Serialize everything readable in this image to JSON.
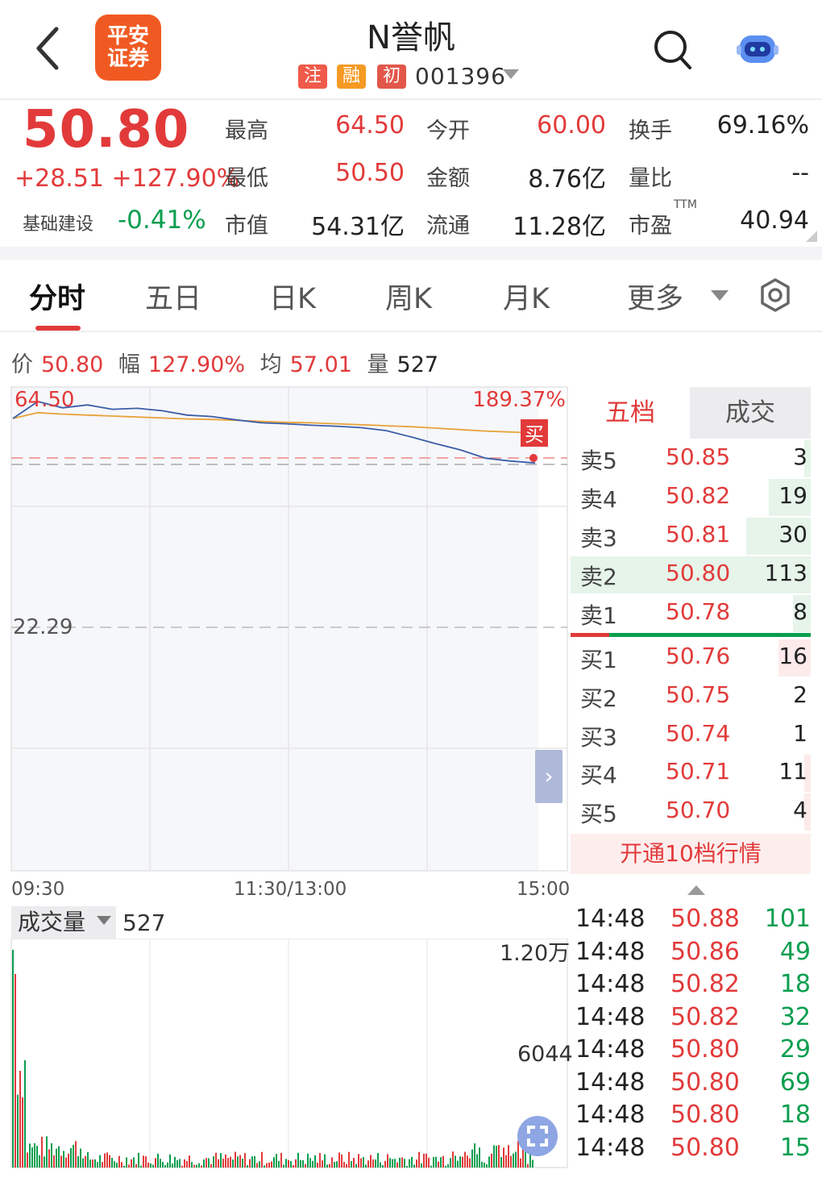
{
  "header": {
    "logo_line1": "平安",
    "logo_line2": "证券",
    "stock_name": "N誉帆",
    "tags": [
      "注",
      "融",
      "初"
    ],
    "stock_code": "001396",
    "icons": [
      "chevron-left-icon",
      "search-icon",
      "robot-assistant-icon"
    ]
  },
  "quote": {
    "price": "50.80",
    "change": "+28.51 +127.90%",
    "sector_name": "基础建设",
    "sector_change": "-0.41%",
    "fields": [
      {
        "label": "最高",
        "value": "64.50",
        "color": "#e23a3a"
      },
      {
        "label": "今开",
        "value": "60.00",
        "color": "#e23a3a"
      },
      {
        "label": "换手",
        "value": "69.16%",
        "color": "#222222"
      },
      {
        "label": "最低",
        "value": "50.50",
        "color": "#e23a3a"
      },
      {
        "label": "金额",
        "value": "8.76亿",
        "color": "#222222"
      },
      {
        "label": "量比",
        "value": "--",
        "color": "#222222"
      },
      {
        "label": "市值",
        "value": "54.31亿",
        "color": "#222222"
      },
      {
        "label": "流通",
        "value": "11.28亿",
        "color": "#222222"
      },
      {
        "label": "市盈",
        "value": "40.94",
        "color": "#222222"
      }
    ],
    "ttm_label": "TTM"
  },
  "tabs": [
    "分时",
    "五日",
    "日K",
    "周K",
    "月K",
    "更多"
  ],
  "info_line": {
    "price_label": "价",
    "price": "50.80",
    "amp_label": "幅",
    "amp": "127.90%",
    "avg_label": "均",
    "avg": "57.01",
    "vol_label": "量",
    "vol": "527"
  },
  "chart": {
    "high_label": "64.50",
    "high_pct": "189.37%",
    "mid_label": "22.29",
    "buy_marker": "买",
    "time_labels": [
      "09:30",
      "11:30/13:00",
      "15:00"
    ]
  },
  "chart_data": {
    "type": "line",
    "series": [
      {
        "name": "价",
        "values": [
          60.0,
          63.5,
          62.2,
          62.8,
          61.9,
          62.1,
          61.6,
          60.7,
          60.4,
          59.7,
          59.1,
          58.9,
          58.6,
          58.4,
          58.1,
          57.5,
          56.2,
          54.8,
          53.5,
          51.8,
          51.2,
          50.8
        ]
      },
      {
        "name": "均",
        "values": [
          60.0,
          61.2,
          60.9,
          60.7,
          60.5,
          60.3,
          60.1,
          59.9,
          59.8,
          59.6,
          59.4,
          59.2,
          59.1,
          58.9,
          58.7,
          58.5,
          58.3,
          58.0,
          57.7,
          57.4,
          57.2,
          57.01
        ]
      }
    ],
    "ylim": [
      50.5,
      64.5
    ],
    "volume_marks": [
      "1.20万",
      "6044"
    ]
  },
  "order_book": {
    "tab_active": "五档",
    "tab_other": "成交",
    "asks": [
      {
        "label": "卖5",
        "price": "50.85",
        "vol": "3"
      },
      {
        "label": "卖4",
        "price": "50.82",
        "vol": "19"
      },
      {
        "label": "卖3",
        "price": "50.81",
        "vol": "30"
      },
      {
        "label": "卖2",
        "price": "50.80",
        "vol": "113"
      },
      {
        "label": "卖1",
        "price": "50.78",
        "vol": "8"
      }
    ],
    "bids": [
      {
        "label": "买1",
        "price": "50.76",
        "vol": "16"
      },
      {
        "label": "买2",
        "price": "50.75",
        "vol": "2"
      },
      {
        "label": "买3",
        "price": "50.74",
        "vol": "1"
      },
      {
        "label": "买4",
        "price": "50.71",
        "vol": "11"
      },
      {
        "label": "买5",
        "price": "50.70",
        "vol": "4"
      }
    ],
    "l2_button": "开通10档行情"
  },
  "volume": {
    "selector_label": "成交量",
    "value": "527"
  },
  "trades": [
    {
      "time": "14:48",
      "price": "50.88",
      "vol": "101"
    },
    {
      "time": "14:48",
      "price": "50.86",
      "vol": "49"
    },
    {
      "time": "14:48",
      "price": "50.82",
      "vol": "18"
    },
    {
      "time": "14:48",
      "price": "50.82",
      "vol": "32"
    },
    {
      "time": "14:48",
      "price": "50.80",
      "vol": "29"
    },
    {
      "time": "14:48",
      "price": "50.80",
      "vol": "69"
    },
    {
      "time": "14:48",
      "price": "50.80",
      "vol": "18"
    },
    {
      "time": "14:48",
      "price": "50.80",
      "vol": "15"
    }
  ]
}
